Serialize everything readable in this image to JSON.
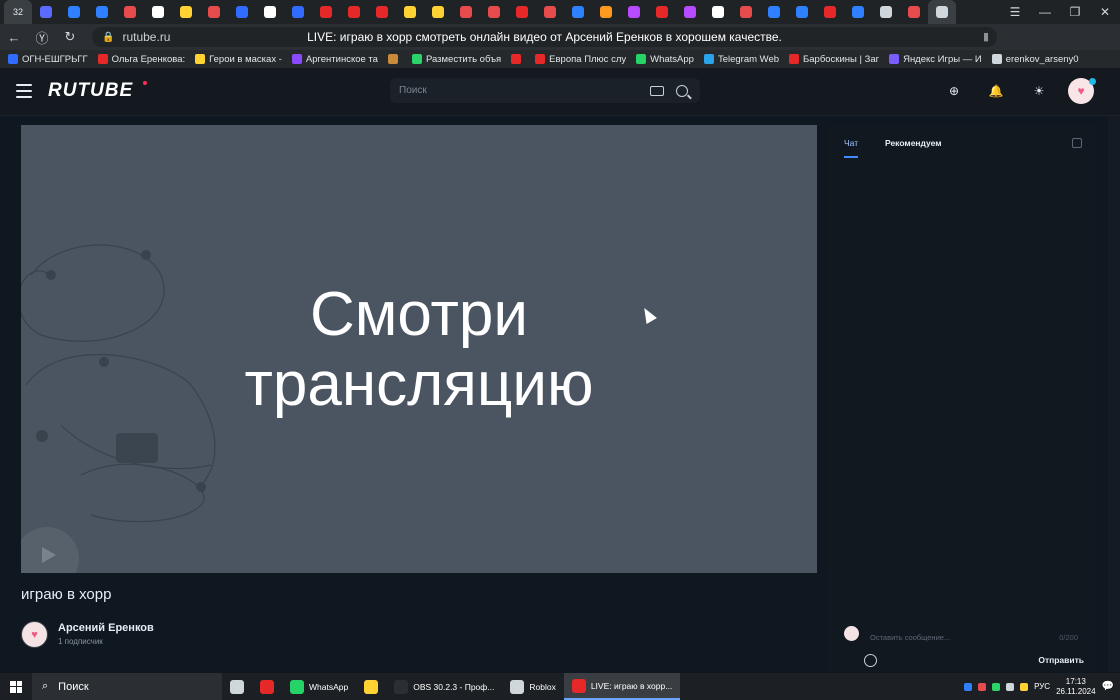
{
  "browser": {
    "tab_colors": [
      "#5b6bff",
      "#2f80ff",
      "#2f80ff",
      "#e84b4b",
      "#ffffff",
      "#ffd233",
      "#e84b4b",
      "#2f6cff",
      "#ffffff",
      "#2f6cff",
      "#e62828",
      "#e62828",
      "#e62828",
      "#ffd233",
      "#ffd233",
      "#e84b4b",
      "#e84b4b",
      "#e62828",
      "#e84b4b",
      "#2f80ff",
      "#ff9a1f",
      "#b84bff",
      "#e62828",
      "#b84bff",
      "#ffffff",
      "#e84b4b",
      "#2f80ff",
      "#2f80ff",
      "#e62828",
      "#2f80ff",
      "#cfd6dc",
      "#e84b4b",
      "#cfd6dc"
    ],
    "tab_counter": "32",
    "url": "rutube.ru",
    "page_title": "LIVE: играю в хорр смотреть онлайн видео от Арсений Еренков в хорошем качестве."
  },
  "bookmarks": [
    {
      "label": "ОГН-ЕШГРЬГГ",
      "color": "#2f6cff"
    },
    {
      "label": "Ольга Еренкова:",
      "color": "#e62828"
    },
    {
      "label": "Герои в масках -",
      "color": "#ffd233"
    },
    {
      "label": "Аргентинское та",
      "color": "#8a4bff"
    },
    {
      "label": "",
      "color": "#c98a3a"
    },
    {
      "label": "Разместить объя",
      "color": "#2bd46a"
    },
    {
      "label": "",
      "color": "#e62828"
    },
    {
      "label": "Европа Плюс слу",
      "color": "#e62828"
    },
    {
      "label": "WhatsApp",
      "color": "#25d366"
    },
    {
      "label": "Telegram Web",
      "color": "#2aa3e8"
    },
    {
      "label": "Барбоскины | Заг",
      "color": "#e62828"
    },
    {
      "label": "Яндекс Игры — И",
      "color": "#7a5cff"
    },
    {
      "label": "erenkov_arseny0",
      "color": "#cfd6dc"
    }
  ],
  "header": {
    "logo": "RUTUBE",
    "search_placeholder": "Поиск"
  },
  "player": {
    "line1": "Смотри",
    "line2": "трансляцию"
  },
  "video": {
    "title": "играю в хорр",
    "channel_name": "Арсений Еренков",
    "subscribers": "1 подписчик"
  },
  "chat": {
    "tab_chat": "Чат",
    "tab_recommend": "Рекомендуем",
    "input_placeholder": "Оставить сообщение...",
    "char_count": "0/200",
    "send_label": "Отправить"
  },
  "taskbar": {
    "search_label": "Поиск",
    "items": [
      {
        "label": "",
        "color": "#cfd6dc"
      },
      {
        "label": "",
        "color": "#e62828"
      },
      {
        "label": "WhatsApp",
        "color": "#25d366"
      },
      {
        "label": "",
        "color": "#ffd233"
      },
      {
        "label": "OBS 30.2.3 - Проф...",
        "color": "#2b2f34"
      },
      {
        "label": "Roblox",
        "color": "#cfd6dc"
      },
      {
        "label": "LIVE: играю в хорр...",
        "color": "#e62828"
      }
    ],
    "tray_lang": "РУС",
    "time": "17:13",
    "date": "26.11.2024"
  }
}
